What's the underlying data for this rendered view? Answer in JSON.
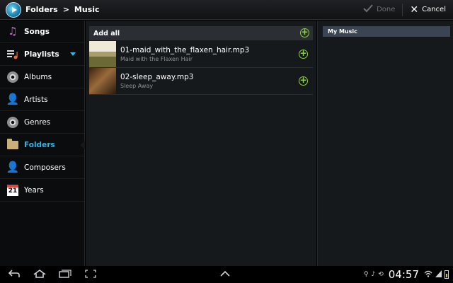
{
  "header": {
    "app_icon": "music-player-icon",
    "breadcrumb": [
      "Folders",
      ">",
      "Music"
    ],
    "done_label": "Done",
    "done_icon": "check-icon",
    "cancel_label": "Cancel",
    "cancel_icon": "close-icon"
  },
  "sidebar": {
    "items": [
      {
        "label": "Songs",
        "icon": "music-note-icon"
      },
      {
        "label": "Playlists",
        "icon": "playlist-icon"
      },
      {
        "label": "Albums",
        "icon": "disc-icon"
      },
      {
        "label": "Artists",
        "icon": "person-icon"
      },
      {
        "label": "Genres",
        "icon": "disc-icon"
      },
      {
        "label": "Folders",
        "icon": "folder-icon",
        "active": true
      },
      {
        "label": "Composers",
        "icon": "person-icon"
      },
      {
        "label": "Years",
        "icon": "calendar-icon",
        "icon_text": "21"
      }
    ]
  },
  "middle": {
    "add_all_label": "Add all",
    "tracks": [
      {
        "title": "01-maid_with_the_flaxen_hair.mp3",
        "subtitle": "Maid with the Flaxen Hair"
      },
      {
        "title": "02-sleep_away.mp3",
        "subtitle": "Sleep Away"
      }
    ]
  },
  "right": {
    "playlist_name": "My Music"
  },
  "system_bar": {
    "time": "04:57",
    "buttons": [
      "back-icon",
      "home-icon",
      "recent-apps-icon",
      "screenshot-icon"
    ]
  },
  "colors": {
    "accent": "#34b5e5",
    "add_green": "#8bd14a",
    "panel_bg": "#16191c",
    "header_bg": "#2b2f34"
  }
}
